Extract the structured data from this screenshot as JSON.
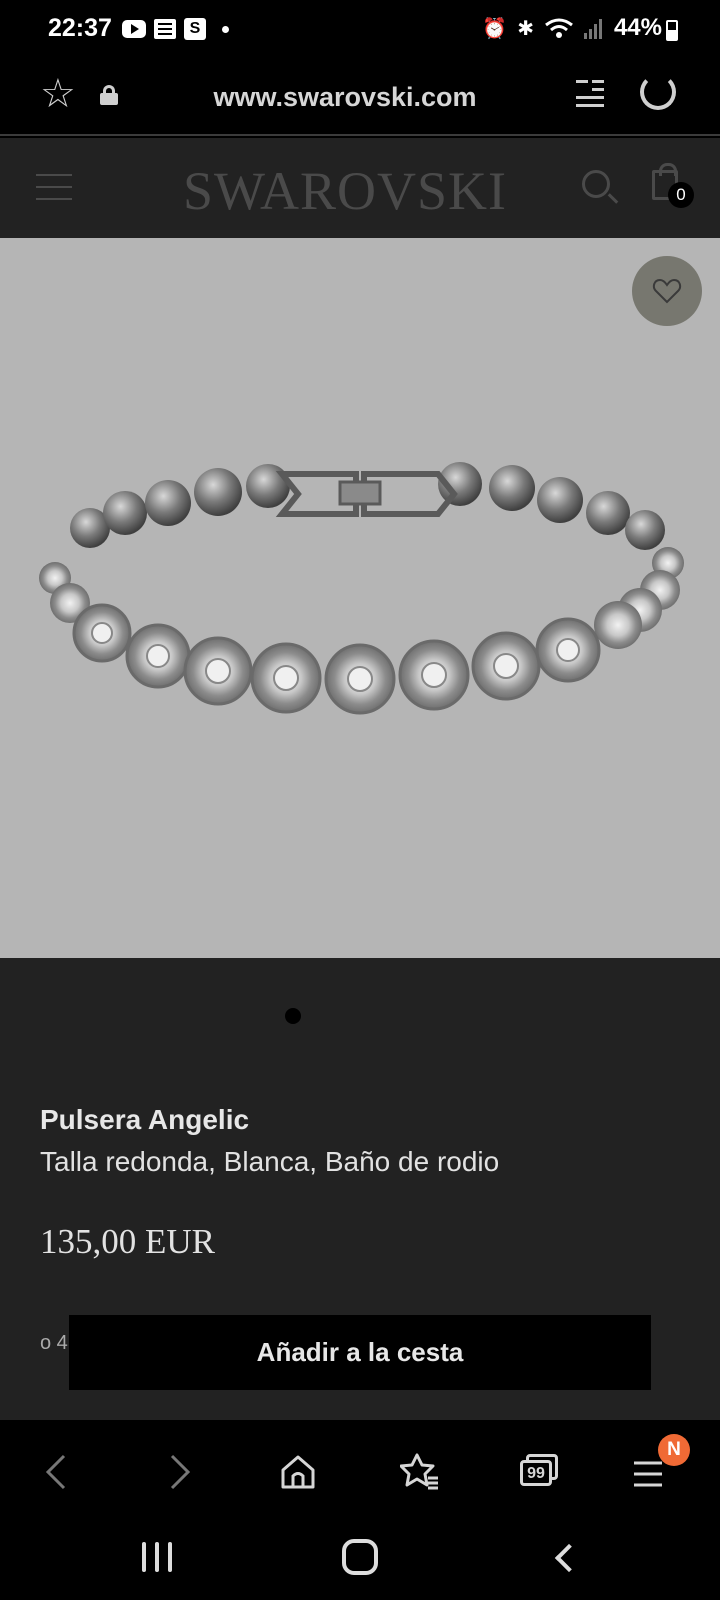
{
  "status_bar": {
    "time": "22:37",
    "battery": "44%",
    "icons": [
      "youtube-icon",
      "sheet-icon",
      "s-app-icon",
      "notification-dot-icon",
      "alarm-icon",
      "bluetooth-icon",
      "wifi-icon",
      "signal-icon",
      "battery-icon"
    ]
  },
  "browser": {
    "url": "www.swarovski.com"
  },
  "site": {
    "logo": "SWAROVSKI",
    "cart_count": "0"
  },
  "product": {
    "name": "Pulsera Angelic",
    "description": "Talla redonda, Blanca, Baño de rodio",
    "price": "135,00 EUR",
    "partial_text": "o 4",
    "add_to_cart": "Añadir a la cesta",
    "gallery_pages": 1
  },
  "toolbar": {
    "tabs_count": "99",
    "menu_badge": "N"
  },
  "colors": {
    "image_bg": "#b5b5b5",
    "info_bg": "#222222",
    "badge": "#f06a35"
  }
}
